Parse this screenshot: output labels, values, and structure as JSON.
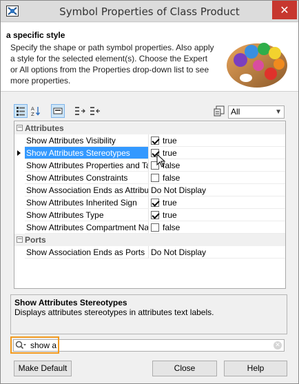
{
  "window": {
    "title": "Symbol Properties of Class Product",
    "close_glyph": "✕"
  },
  "header": {
    "title": "a specific style",
    "description": "Specify the shape or path symbol properties. Also apply a style for the selected element(s). Choose the Expert or All options from the Properties drop-down list to see more properties.",
    "image_icon": "palette-icon"
  },
  "toolbar": {
    "buttons": [
      "categorized-icon",
      "sort-alpha-icon",
      "view-icon",
      "expand-all-icon",
      "collapse-all-icon"
    ],
    "filter_icon": "filter-options-icon",
    "filter_value": "All"
  },
  "properties": {
    "groups": [
      {
        "name": "Attributes",
        "rows": [
          {
            "name": "Show Attributes Visibility",
            "type": "check",
            "checked": true,
            "value": "true"
          },
          {
            "name": "Show Attributes Stereotypes",
            "type": "check",
            "checked": true,
            "value": "true",
            "selected": true
          },
          {
            "name": "Show Attributes Properties and Ta...",
            "type": "check",
            "checked": false,
            "value": "false"
          },
          {
            "name": "Show Attributes Constraints",
            "type": "check",
            "checked": false,
            "value": "false"
          },
          {
            "name": "Show Association Ends as Attributes",
            "type": "text",
            "value": "Do Not Display"
          },
          {
            "name": "Show Attributes Inherited Sign",
            "type": "check",
            "checked": true,
            "value": "true"
          },
          {
            "name": "Show Attributes Type",
            "type": "check",
            "checked": true,
            "value": "true"
          },
          {
            "name": "Show Attributes Compartment Name",
            "type": "check",
            "checked": false,
            "value": "false"
          }
        ]
      },
      {
        "name": "Ports",
        "rows": [
          {
            "name": "Show Association Ends as Ports",
            "type": "text",
            "value": "Do Not Display"
          }
        ]
      }
    ]
  },
  "description": {
    "title": "Show Attributes Stereotypes",
    "text": "Displays attributes stereotypes in attributes text labels."
  },
  "search": {
    "value": "show a",
    "icon": "search-icon",
    "clear_icon": "clear-icon"
  },
  "buttons": {
    "make_default": "Make Default",
    "close": "Close",
    "help": "Help"
  },
  "colors": {
    "selection": "#3399ff",
    "close_button": "#c7372f",
    "search_highlight": "#f29a20"
  }
}
